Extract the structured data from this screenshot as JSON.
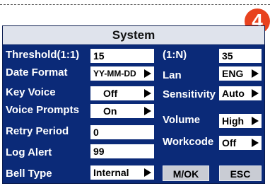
{
  "badge": "4",
  "window": {
    "title": "System"
  },
  "left": {
    "threshold": {
      "label": "Threshold(1:1)",
      "value": "15"
    },
    "date_format": {
      "label": "Date Format",
      "value": "YY-MM-DD"
    },
    "key_voice": {
      "label": "Key Voice",
      "value": "Off"
    },
    "voice_prompts": {
      "label": "Voice Prompts",
      "value": "On"
    },
    "retry_period": {
      "label": "Retry Period",
      "value": "0"
    },
    "log_alert": {
      "label": "Log Alert",
      "value": "99"
    },
    "bell_type": {
      "label": "Bell Type",
      "value": "Internal"
    }
  },
  "right": {
    "one_to_n": {
      "label": "(1:N)",
      "value": "35"
    },
    "lan": {
      "label": "Lan",
      "value": "ENG"
    },
    "sensitivity": {
      "label": "Sensitivity",
      "value": "Auto"
    },
    "volume": {
      "label": "Volume",
      "value": "High"
    },
    "workcode": {
      "label": "Workcode",
      "value": "Off"
    }
  },
  "buttons": {
    "ok": "M/OK",
    "esc": "ESC"
  },
  "colors": {
    "screen_bg": "#0b2a78",
    "badge": "#e8421e",
    "titlebar": "#dfe3ec"
  }
}
